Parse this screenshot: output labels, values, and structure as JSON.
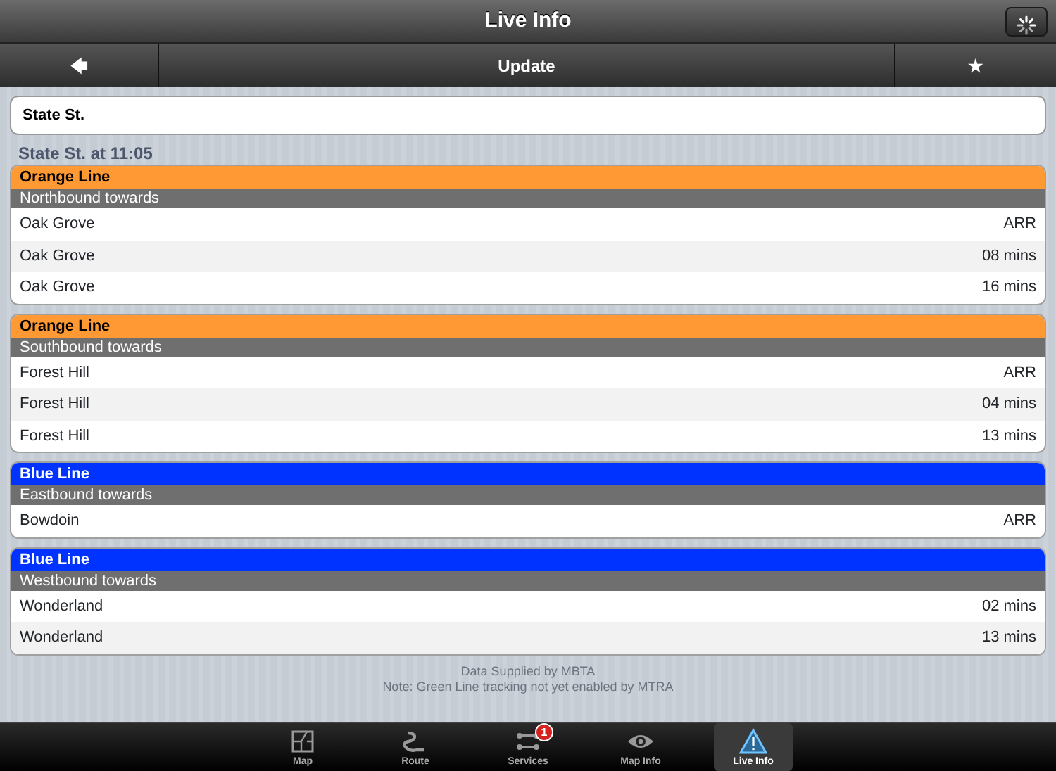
{
  "window": {
    "title": "Live Info"
  },
  "toolbar": {
    "back": "🡄",
    "update": "Update",
    "favorite": "★"
  },
  "search": {
    "value": "State St."
  },
  "heading": "State St. at 11:05",
  "groups": [
    {
      "line": "Orange Line",
      "color": "#ff9933",
      "direction": "Northbound towards",
      "rows": [
        {
          "stop": "Oak Grove",
          "time": "ARR"
        },
        {
          "stop": "Oak Grove",
          "time": "08 mins"
        },
        {
          "stop": "Oak Grove",
          "time": "16 mins"
        }
      ]
    },
    {
      "line": "Orange Line",
      "color": "#ff9933",
      "direction": "Southbound towards",
      "rows": [
        {
          "stop": "Forest Hill",
          "time": "ARR"
        },
        {
          "stop": "Forest Hill",
          "time": "04 mins"
        },
        {
          "stop": "Forest Hill",
          "time": "13 mins"
        }
      ]
    },
    {
      "line": "Blue Line",
      "color": "#0033ff",
      "direction": "Eastbound towards",
      "rows": [
        {
          "stop": "Bowdoin",
          "time": "ARR"
        }
      ]
    },
    {
      "line": "Blue Line",
      "color": "#0033ff",
      "direction": "Westbound towards",
      "rows": [
        {
          "stop": "Wonderland",
          "time": "02 mins"
        },
        {
          "stop": "Wonderland",
          "time": "13 mins"
        }
      ]
    }
  ],
  "footer": [
    "Data Supplied by MBTA",
    "Note: Green Line tracking not yet enabled by MTRA"
  ],
  "tabs": [
    {
      "label": "Map",
      "kind": "map",
      "selected": false
    },
    {
      "label": "Route",
      "kind": "route",
      "selected": false
    },
    {
      "label": "Services",
      "kind": "services",
      "selected": false,
      "badge": "1"
    },
    {
      "label": "Map Info",
      "kind": "eye",
      "selected": false
    },
    {
      "label": "Live Info",
      "kind": "alert",
      "selected": true
    }
  ]
}
